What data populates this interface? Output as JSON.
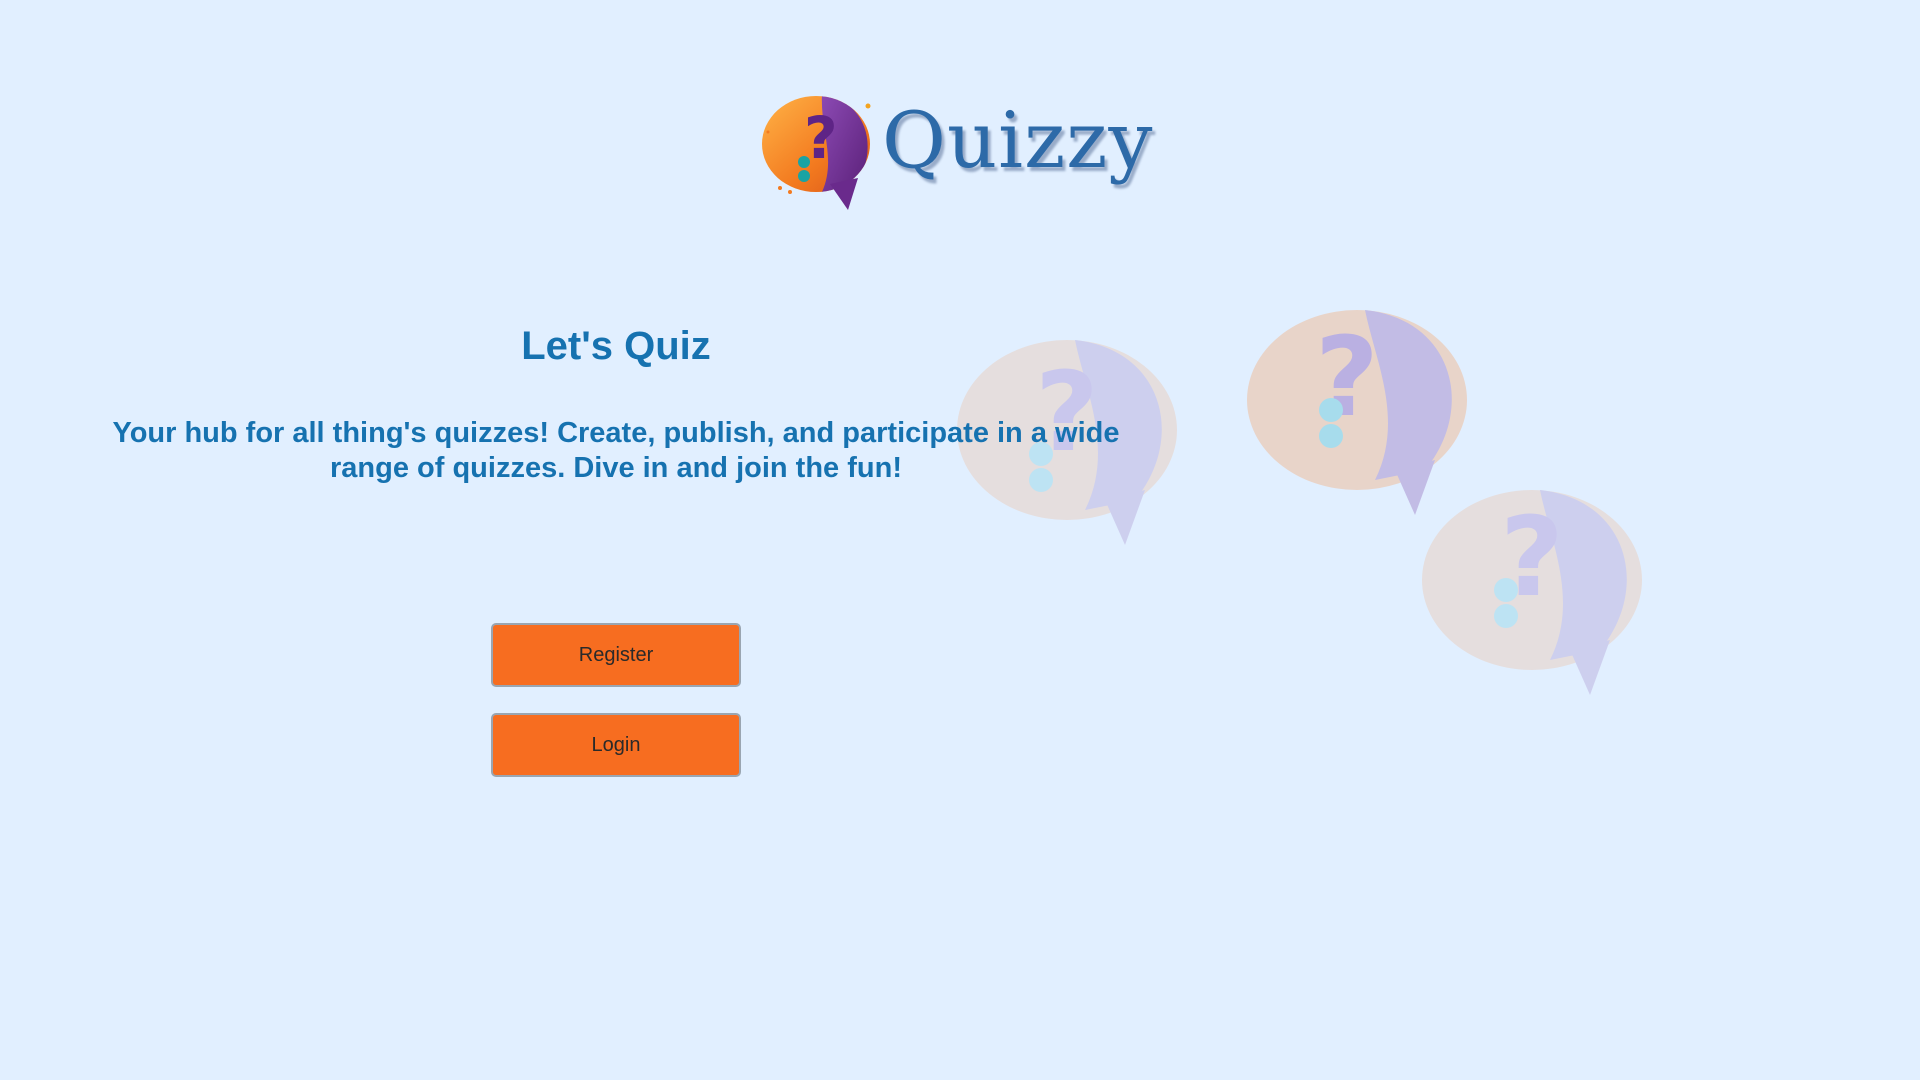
{
  "brand": {
    "name": "Quizzy",
    "logo_icon": "question-speech-bubble-icon",
    "colors": {
      "wordmark": "#2d6aa8",
      "bubble_orange": "#f37a1f",
      "bubble_purple": "#6a2a8c",
      "dots_teal": "#1aa3a3"
    }
  },
  "hero": {
    "title": "Let's Quiz",
    "subtitle": "Your hub for all thing's quizzes! Create, publish, and participate in a wide range of quizzes. Dive in and join the fun!"
  },
  "actions": {
    "register_label": "Register",
    "login_label": "Login"
  },
  "theme": {
    "background": "#e1efff",
    "text_accent": "#1672b0",
    "button_bg": "#f76d20"
  },
  "decorations": {
    "background_icons": [
      "question-speech-bubble-icon",
      "question-speech-bubble-icon",
      "question-speech-bubble-icon"
    ]
  }
}
